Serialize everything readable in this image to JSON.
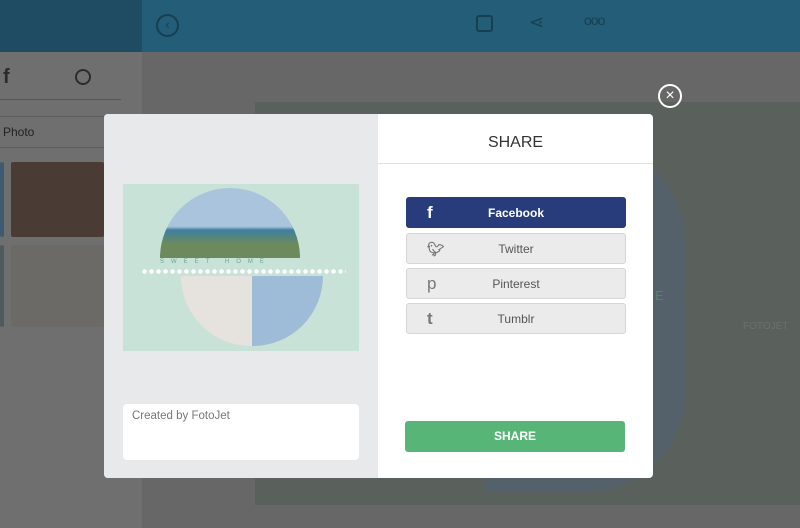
{
  "background": {
    "sidebar": {
      "photo_label": "Photo"
    },
    "canvas": {
      "watermark": "FOTOJET",
      "letter": "E"
    }
  },
  "toolbar": {
    "icons": [
      "back-icon",
      "save-icon",
      "share-icon",
      "more-icon"
    ]
  },
  "modal": {
    "title": "SHARE",
    "caption_value": "Created by FotoJet",
    "preview": {
      "text": "SWEET HOME"
    },
    "buttons": [
      {
        "label": "Facebook",
        "icon": "facebook-icon",
        "color": "#283c7c"
      },
      {
        "label": "Twitter",
        "icon": "twitter-icon"
      },
      {
        "label": "Pinterest",
        "icon": "pinterest-icon"
      },
      {
        "label": "Tumblr",
        "icon": "tumblr-icon"
      }
    ],
    "share_label": "SHARE",
    "share_color": "#57b677"
  }
}
